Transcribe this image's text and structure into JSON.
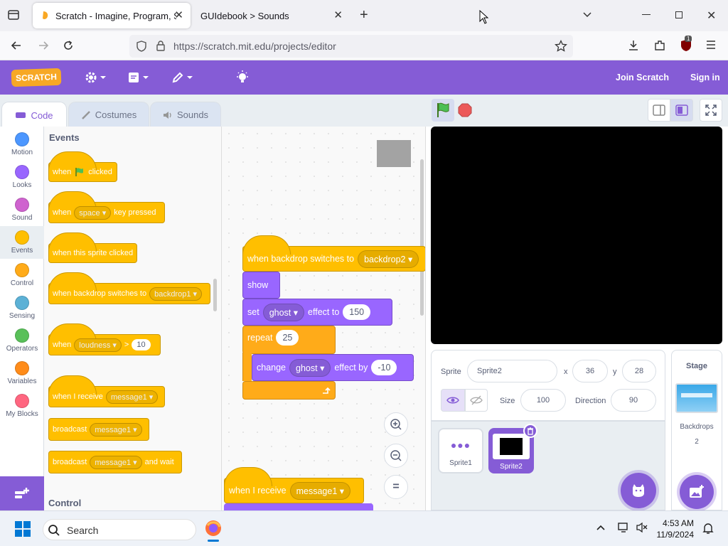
{
  "browser": {
    "tabs": [
      {
        "title": "Scratch - Imagine, Program, Sh"
      },
      {
        "title": "GUIdebook > Sounds"
      }
    ],
    "url": "https://scratch.mit.edu/projects/editor",
    "ext_badge": "1"
  },
  "menubar": {
    "logo": "SCRATCH",
    "join": "Join Scratch",
    "signin": "Sign in"
  },
  "gui_tabs": {
    "code": "Code",
    "costumes": "Costumes",
    "sounds": "Sounds"
  },
  "categories": [
    {
      "label": "Motion",
      "color": "#4c97ff"
    },
    {
      "label": "Looks",
      "color": "#9966ff"
    },
    {
      "label": "Sound",
      "color": "#cf63cf"
    },
    {
      "label": "Events",
      "color": "#ffbf00"
    },
    {
      "label": "Control",
      "color": "#ffab19"
    },
    {
      "label": "Sensing",
      "color": "#5cb1d6"
    },
    {
      "label": "Operators",
      "color": "#59c059"
    },
    {
      "label": "Variables",
      "color": "#ff8c1a"
    },
    {
      "label": "My Blocks",
      "color": "#ff6680"
    }
  ],
  "palette": {
    "title": "Events",
    "next_title": "Control",
    "flag_when": "when",
    "flag_clicked": "clicked",
    "key_when": "when",
    "key_dd": "space",
    "key_pressed": "key pressed",
    "sprite_clicked": "when this sprite clicked",
    "backdrop_when": "when backdrop switches to",
    "backdrop_dd": "backdrop1",
    "loud_when": "when",
    "loud_dd": "loudness",
    "loud_gt": ">",
    "loud_val": "10",
    "recv_text": "when I receive",
    "recv_dd": "message1",
    "bc_text": "broadcast",
    "bc_dd": "message1",
    "bcw_text": "broadcast",
    "bcw_dd": "message1",
    "bcw_wait": "and wait"
  },
  "script": {
    "hat_text": "when backdrop switches to",
    "hat_dd": "backdrop2",
    "show": "show",
    "set": "set",
    "set_dd": "ghost",
    "set_effect": "effect to",
    "set_val": "150",
    "repeat": "repeat",
    "repeat_val": "25",
    "change": "change",
    "change_dd": "ghost",
    "change_effect": "effect by",
    "change_val": "-10",
    "recv_text": "when I receive",
    "recv_dd": "message1",
    "zoom_reset": "="
  },
  "sprite_info": {
    "sprite_label": "Sprite",
    "sprite_name": "Sprite2",
    "x_label": "x",
    "x_val": "36",
    "y_label": "y",
    "y_val": "28",
    "size_label": "Size",
    "size_val": "100",
    "dir_label": "Direction",
    "dir_val": "90"
  },
  "sprites": [
    {
      "name": "Sprite1"
    },
    {
      "name": "Sprite2"
    }
  ],
  "stage_pane": {
    "title": "Stage",
    "backdrops_label": "Backdrops",
    "backdrops_count": "2"
  },
  "taskbar": {
    "search": "Search",
    "time": "4:53 AM",
    "date": "11/9/2024"
  }
}
